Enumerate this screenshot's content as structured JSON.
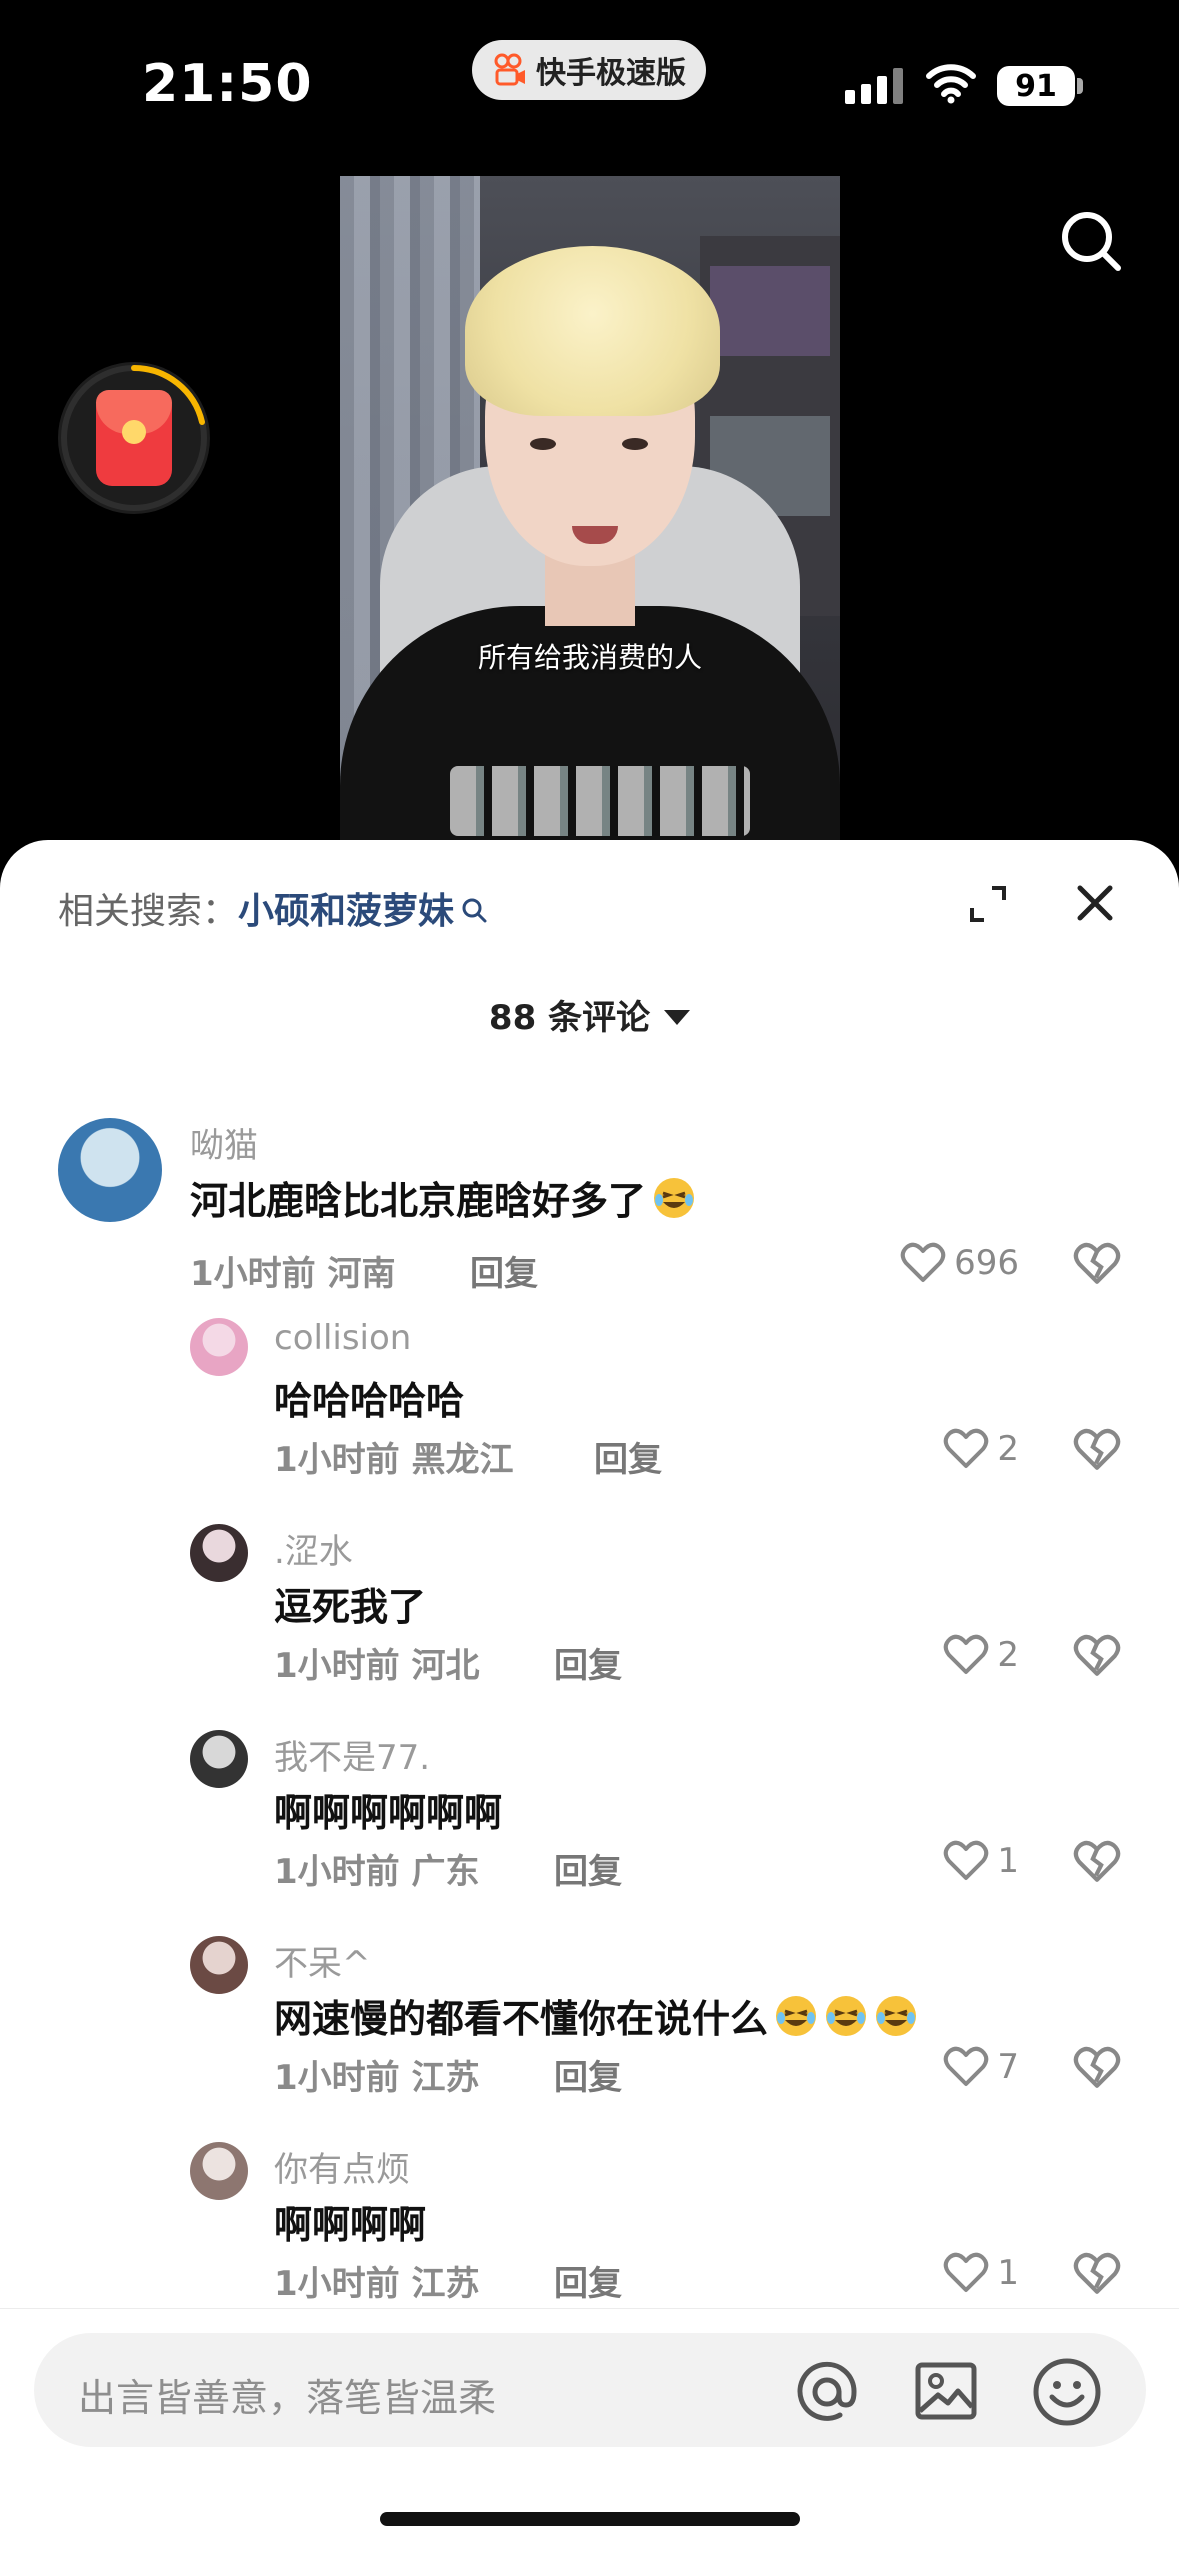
{
  "status": {
    "time": "21:50",
    "app_badge": "快手极速版",
    "battery": "91"
  },
  "video": {
    "subtitle": "所有给我消费的人"
  },
  "sheet": {
    "related_label": "相关搜索：",
    "related_term": "小硕和菠萝妹",
    "comment_count": "88 条评论"
  },
  "comments": [
    {
      "user": "呦猫",
      "text": "河北鹿晗比北京鹿晗好多了",
      "emojis": 1,
      "time": "1小时前",
      "region": "河南",
      "reply": "回复",
      "likes": "696"
    },
    {
      "user": "collision",
      "text": "哈哈哈哈哈",
      "emojis": 0,
      "time": "1小时前",
      "region": "黑龙江",
      "reply": "回复",
      "likes": "2"
    },
    {
      "user": ".涩水",
      "text": "逗死我了",
      "emojis": 0,
      "time": "1小时前",
      "region": "河北",
      "reply": "回复",
      "likes": "2"
    },
    {
      "user": "我不是77.",
      "text": "啊啊啊啊啊啊",
      "emojis": 0,
      "time": "1小时前",
      "region": "广东",
      "reply": "回复",
      "likes": "1"
    },
    {
      "user": "不呆^",
      "text": "网速慢的都看不懂你在说什么",
      "emojis": 3,
      "time": "1小时前",
      "region": "江苏",
      "reply": "回复",
      "likes": "7"
    },
    {
      "user": "你有点烦",
      "text": "啊啊啊啊",
      "emojis": 0,
      "time": "1小时前",
      "region": "江苏",
      "reply": "回复",
      "likes": "1"
    }
  ],
  "input": {
    "placeholder": "出言皆善意，落笔皆温柔"
  },
  "icons": {
    "search": "search-icon",
    "expand": "expand-icon",
    "close": "close-icon",
    "heart": "heart-icon",
    "dislike": "broken-heart-icon",
    "at": "at-icon",
    "image": "image-icon",
    "emoji": "smile-icon",
    "red_packet": "red-packet-icon"
  },
  "colors": {
    "related_term": "#2b4a7a",
    "red_packet": "#ef3b3f",
    "sheet_bg": "#ffffff"
  }
}
